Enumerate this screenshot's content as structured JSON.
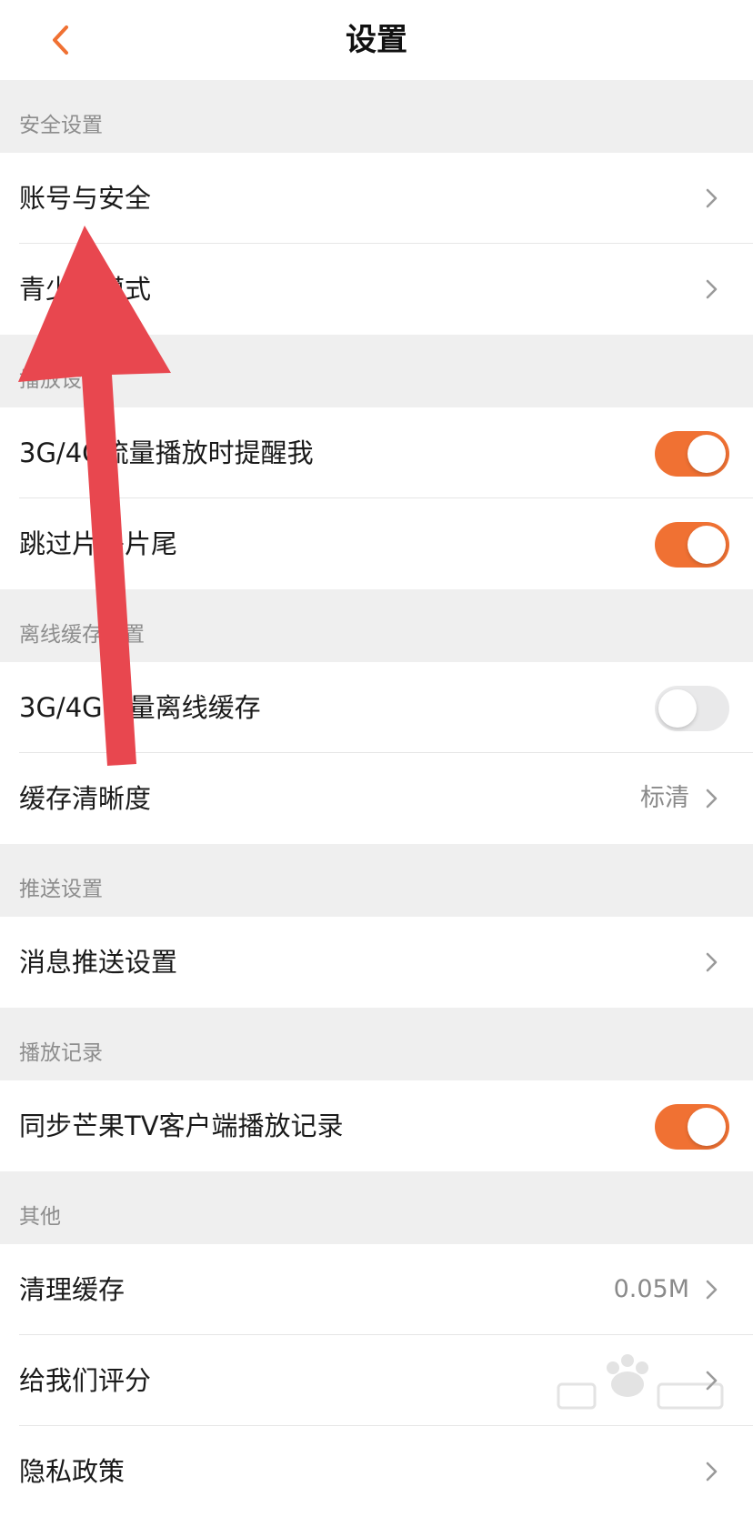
{
  "header": {
    "title": "设置",
    "back_icon": "chevron-left-icon"
  },
  "colors": {
    "accent": "#f07133",
    "toggle_off": "#e9e9ea",
    "section_bg": "#efefef",
    "annotation_arrow": "#e8474f"
  },
  "sections": {
    "security": {
      "header": "安全设置",
      "account": {
        "label": "账号与安全"
      },
      "youth": {
        "label": "青少年模式"
      }
    },
    "playback": {
      "header": "播放设置",
      "cellular_remind": {
        "label": "3G/4G流量播放时提醒我",
        "toggle": true
      },
      "skip_intro": {
        "label": "跳过片头片尾",
        "toggle": true
      }
    },
    "offline": {
      "header": "离线缓存设置",
      "cellular_cache": {
        "label": "3G/4G流量离线缓存",
        "toggle": false
      },
      "cache_quality": {
        "label": "缓存清晰度",
        "value": "标清"
      }
    },
    "push": {
      "header": "推送设置",
      "message_push": {
        "label": "消息推送设置"
      }
    },
    "history": {
      "header": "播放记录",
      "sync": {
        "label": "同步芒果TV客户端播放记录",
        "toggle": true
      }
    },
    "other": {
      "header": "其他",
      "clear_cache": {
        "label": "清理缓存",
        "value": "0.05M"
      },
      "rate_us": {
        "label": "给我们评分"
      },
      "privacy": {
        "label": "隐私政策"
      }
    }
  }
}
